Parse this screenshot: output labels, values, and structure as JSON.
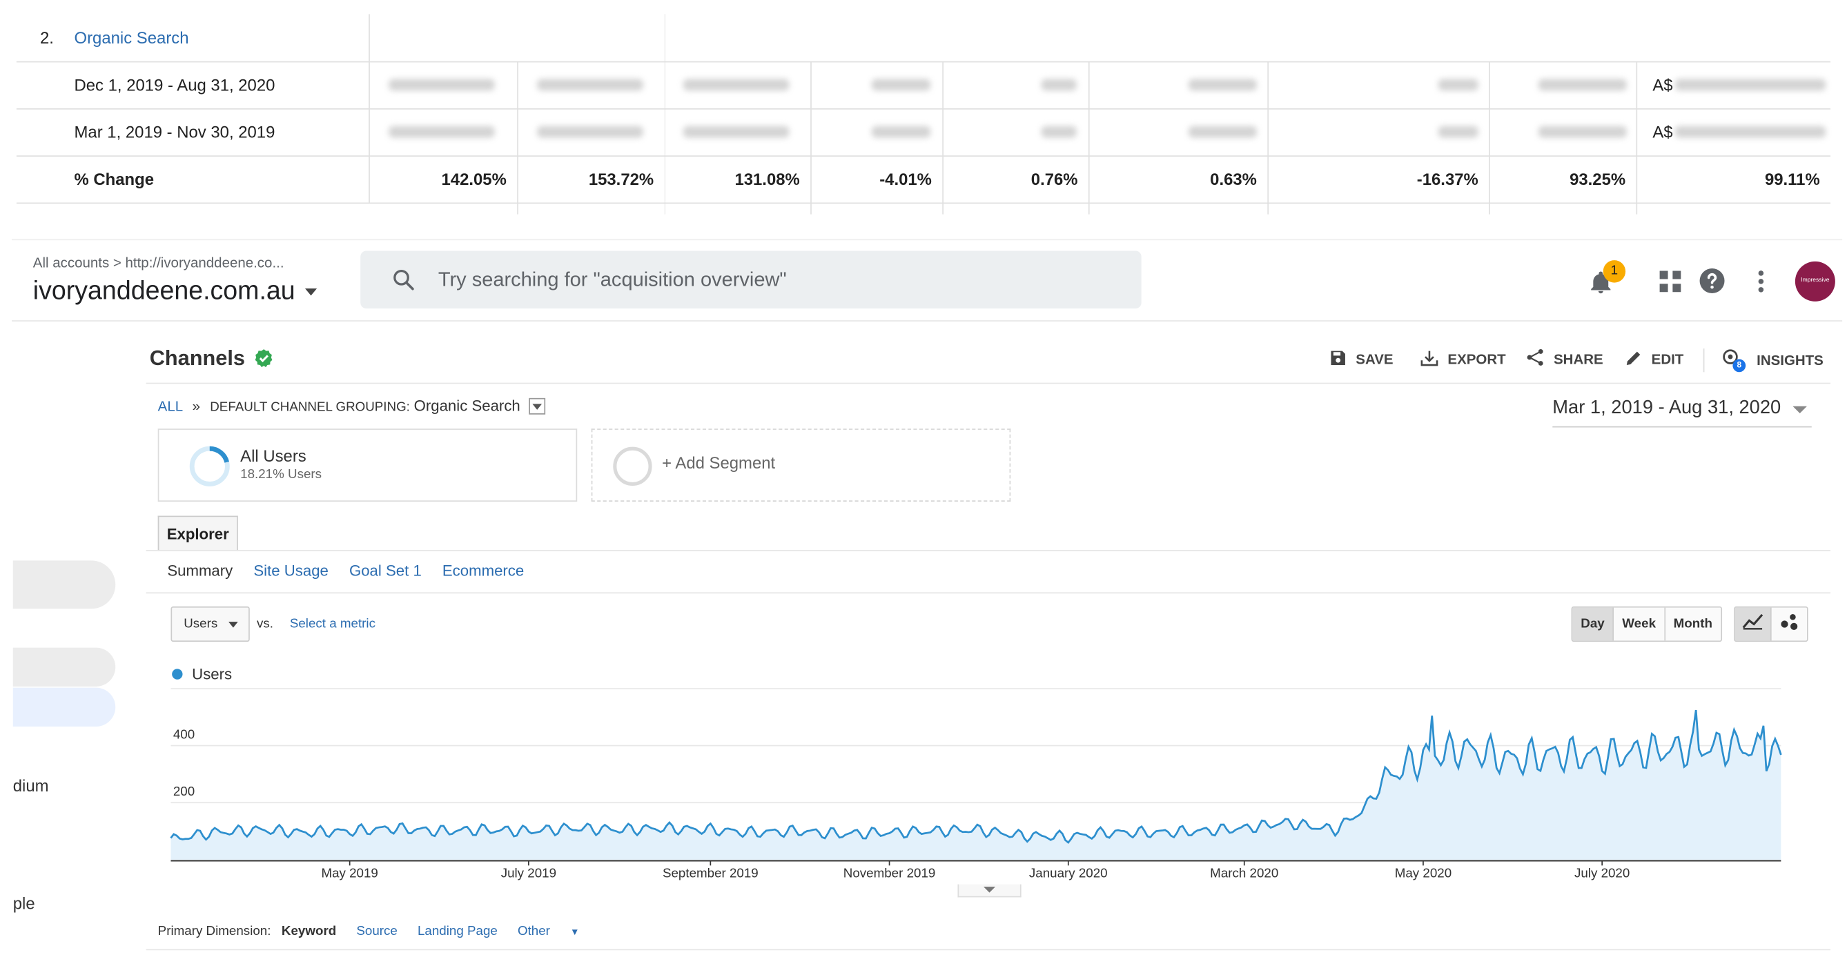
{
  "comparison_table": {
    "row_number": "2.",
    "channel": "Organic Search",
    "rows": [
      {
        "label": "Dec 1, 2019 - Aug 31, 2020",
        "revenue_prefix": "A$"
      },
      {
        "label": "Mar 1, 2019 - Nov 30, 2019",
        "revenue_prefix": "A$"
      }
    ],
    "change_label": "% Change",
    "changes": [
      "142.05%",
      "153.72%",
      "131.08%",
      "-4.01%",
      "0.76%",
      "0.63%",
      "-16.37%",
      "93.25%",
      "99.11%"
    ]
  },
  "header": {
    "breadcrumb": "All accounts > http://ivoryanddeene.co...",
    "property": "ivoryanddeene.com.au",
    "search_placeholder": "Try searching for \"acquisition overview\"",
    "notification_count": "1",
    "avatar_text": "Impressive"
  },
  "nav": {
    "medium_fragment": "dium",
    "people_fragment": "ple"
  },
  "report": {
    "title": "Channels",
    "toolbar": {
      "save": "SAVE",
      "export": "EXPORT",
      "share": "SHARE",
      "edit": "EDIT",
      "insights": "INSIGHTS",
      "insights_badge": "8"
    },
    "breadcrumb": {
      "all": "ALL",
      "sep": "»",
      "grouping": "DEFAULT CHANNEL GROUPING:",
      "value": "Organic Search"
    },
    "date_range": "Mar 1, 2019 - Aug 31, 2020",
    "segments": [
      {
        "name": "All Users",
        "sub": "18.21% Users"
      },
      {
        "name": "+ Add Segment"
      }
    ],
    "tab": "Explorer",
    "subtabs": [
      "Summary",
      "Site Usage",
      "Goal Set 1",
      "Ecommerce"
    ],
    "metric": "Users",
    "vs": "vs.",
    "select_metric": "Select a metric",
    "granularity": [
      "Day",
      "Week",
      "Month"
    ],
    "primary_dimension": {
      "label": "Primary Dimension:",
      "options": [
        "Keyword",
        "Source",
        "Landing Page",
        "Other"
      ]
    }
  },
  "colors": {
    "line": "#2d8fce",
    "fill": "#e3f1fb",
    "link": "#2b6cb0",
    "check": "#34a853"
  },
  "chart_data": {
    "type": "line",
    "legend": [
      "Users"
    ],
    "y_ticks": [
      200,
      400,
      600
    ],
    "ylim": [
      0,
      620
    ],
    "x_ticks": [
      "May 2019",
      "July 2019",
      "September 2019",
      "November 2019",
      "January 2020",
      "March 2020",
      "May 2020",
      "July 2020"
    ],
    "x_start": "2019-03-01",
    "x_end": "2020-08-31",
    "series": [
      {
        "name": "Users",
        "weekly_anchors": [
          [
            "2019-03-01",
            70
          ],
          [
            "2019-03-15",
            95
          ],
          [
            "2019-04-01",
            105
          ],
          [
            "2019-04-15",
            95
          ],
          [
            "2019-05-01",
            100
          ],
          [
            "2019-05-15",
            110
          ],
          [
            "2019-06-01",
            100
          ],
          [
            "2019-06-15",
            105
          ],
          [
            "2019-07-01",
            100
          ],
          [
            "2019-07-15",
            110
          ],
          [
            "2019-08-01",
            105
          ],
          [
            "2019-08-15",
            110
          ],
          [
            "2019-09-01",
            105
          ],
          [
            "2019-09-15",
            95
          ],
          [
            "2019-10-01",
            100
          ],
          [
            "2019-10-15",
            90
          ],
          [
            "2019-11-01",
            95
          ],
          [
            "2019-11-15",
            100
          ],
          [
            "2019-12-01",
            105
          ],
          [
            "2019-12-15",
            85
          ],
          [
            "2020-01-01",
            80
          ],
          [
            "2020-01-15",
            95
          ],
          [
            "2020-02-01",
            95
          ],
          [
            "2020-02-15",
            100
          ],
          [
            "2020-03-01",
            110
          ],
          [
            "2020-03-15",
            130
          ],
          [
            "2020-04-01",
            105
          ],
          [
            "2020-04-10",
            170
          ],
          [
            "2020-04-20",
            300
          ],
          [
            "2020-05-01",
            360
          ],
          [
            "2020-05-15",
            390
          ],
          [
            "2020-06-01",
            350
          ],
          [
            "2020-06-15",
            370
          ],
          [
            "2020-07-01",
            360
          ],
          [
            "2020-07-15",
            380
          ],
          [
            "2020-08-01",
            390
          ],
          [
            "2020-08-15",
            400
          ],
          [
            "2020-08-31",
            370
          ]
        ]
      }
    ]
  }
}
